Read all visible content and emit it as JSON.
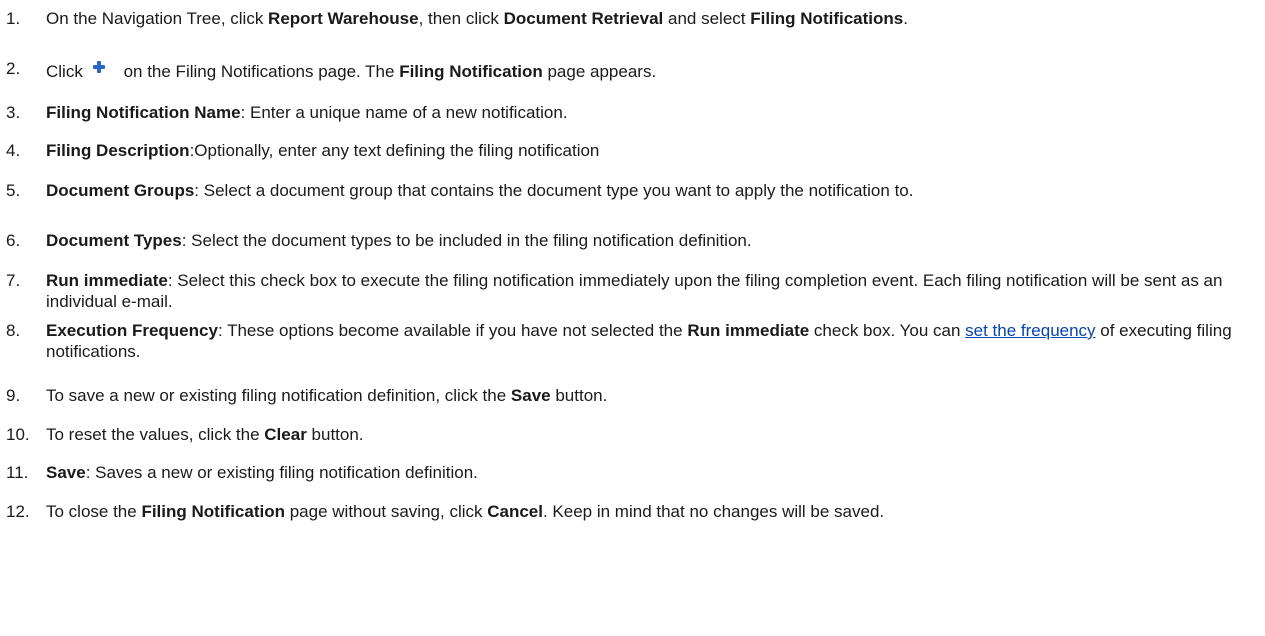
{
  "steps": [
    {
      "num": "1.",
      "parts": [
        {
          "t": "On the Navigation Tree, click "
        },
        {
          "t": "Report Warehouse",
          "b": true
        },
        {
          "t": ", then click "
        },
        {
          "t": "Document Retrieval",
          "b": true
        },
        {
          "t": " and select "
        },
        {
          "t": "Filing Notifications",
          "b": true
        },
        {
          "t": "."
        }
      ]
    },
    {
      "num": "2.",
      "parts": [
        {
          "t": "Click"
        },
        {
          "icon": "add-icon"
        },
        {
          "t": " on the Filing Notifications page. The "
        },
        {
          "t": "Filing Notification",
          "b": true
        },
        {
          "t": " page appears."
        }
      ]
    },
    {
      "num": "3.",
      "parts": [
        {
          "t": "Filing Notification Name",
          "b": true
        },
        {
          "t": ": Enter a unique name of a new notification."
        }
      ]
    },
    {
      "num": "4.",
      "parts": [
        {
          "t": "Filing Description",
          "b": true
        },
        {
          "t": ":Optionally, enter any text defining the filing notification"
        }
      ]
    },
    {
      "num": "5.",
      "parts": [
        {
          "t": "Document Groups",
          "b": true
        },
        {
          "t": ": Select a document group that contains the document type you want to apply the notification to."
        }
      ]
    },
    {
      "num": "6.",
      "parts": [
        {
          "t": "Document Types",
          "b": true
        },
        {
          "t": ": Select the document types to be included in the filing notification definition."
        }
      ]
    },
    {
      "num": "7.",
      "parts": [
        {
          "t": "Run immediate",
          "b": true
        },
        {
          "t": ": Select this check box to execute the filing notification immediately upon the filing completion event. Each filing notification will be sent as an individual e-mail."
        }
      ]
    },
    {
      "num": "8.",
      "parts": [
        {
          "t": "Execution Frequency",
          "b": true
        },
        {
          "t": ": These options become available if you have not selected the "
        },
        {
          "t": "Run immediate",
          "b": true
        },
        {
          "t": " check box. You can "
        },
        {
          "t": "set the frequency",
          "link": true
        },
        {
          "t": " of executing filing notifications."
        }
      ]
    },
    {
      "num": "9.",
      "parts": [
        {
          "t": "To save a new or existing filing notification definition, click the "
        },
        {
          "t": "Save",
          "b": true
        },
        {
          "t": " button."
        }
      ]
    },
    {
      "num": "10.",
      "parts": [
        {
          "t": "To reset the values, click the "
        },
        {
          "t": "Clear",
          "b": true
        },
        {
          "t": " button."
        }
      ]
    },
    {
      "num": "11.",
      "parts": [
        {
          "t": "Save",
          "b": true
        },
        {
          "t": ": Saves a new or existing filing notification definition."
        }
      ]
    },
    {
      "num": "12.",
      "parts": [
        {
          "t": "To close the "
        },
        {
          "t": "Filing Notification",
          "b": true
        },
        {
          "t": " page without saving, click "
        },
        {
          "t": "Cancel",
          "b": true
        },
        {
          "t": ". Keep in mind that no changes will be saved."
        }
      ]
    }
  ],
  "colors": {
    "link": "#0645ad",
    "add_icon": "#2a66c9",
    "text": "#1a1a1a"
  }
}
